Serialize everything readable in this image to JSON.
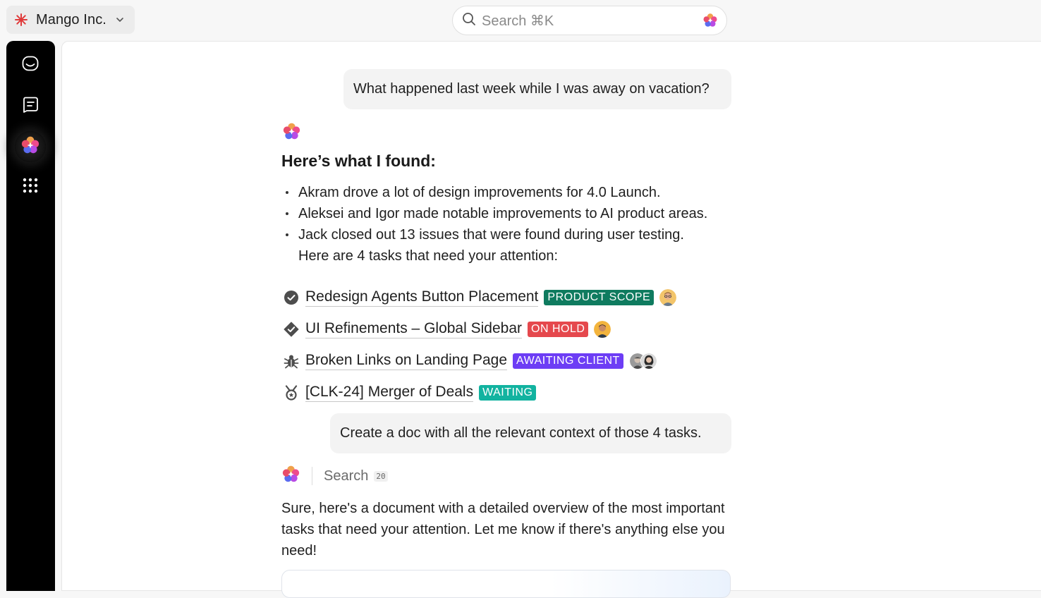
{
  "workspace": {
    "name": "Mango Inc."
  },
  "search": {
    "placeholder": "Search ⌘K"
  },
  "rail": {
    "items": [
      {
        "icon": "inbox-icon"
      },
      {
        "icon": "chat-icon"
      },
      {
        "icon": "ai-brain-icon",
        "active": true
      },
      {
        "icon": "apps-grid-icon"
      }
    ]
  },
  "conversation": {
    "user_message_1": "What happened last week while I was away on vacation?",
    "heading": "Here’s what I found:",
    "bullets": [
      "Akram drove a lot of design improvements for 4.0 Launch.",
      "Aleksei and Igor made notable improvements to AI product areas.",
      "Jack closed out 13 issues that were found during user testing."
    ],
    "bullet_continuation": "Here are 4 tasks that need your attention:",
    "tasks": [
      {
        "title": "Redesign Agents Button Placement",
        "status": "PRODUCT SCOPE",
        "status_color": "#0f7b5f",
        "icon": "check-circle-icon"
      },
      {
        "title": "UI Refinements – Global Sidebar",
        "status": "ON HOLD",
        "status_color": "#e5484d",
        "icon": "check-diamond-icon"
      },
      {
        "title": "Broken Links on Landing Page",
        "status": "AWAITING CLIENT",
        "status_color": "#6d3df5",
        "icon": "bug-icon"
      },
      {
        "title": "[CLK-24] Merger of Deals",
        "status": "WAITING",
        "status_color": "#12b3a0",
        "icon": "medal-icon"
      }
    ],
    "user_message_2": "Create a doc with all the relevant context of those 4 tasks.",
    "search_step": {
      "label": "Search",
      "count": "20"
    },
    "reply": "Sure, here's a document with a detailed overview of the most important tasks that need your attention. Let me know if there's anything else you need!"
  },
  "colors": {
    "rail_bg": "#000000",
    "panel_bg": "#ffffff",
    "bubble_bg": "#f3f3f3",
    "brand_red": "#e03a3a"
  }
}
